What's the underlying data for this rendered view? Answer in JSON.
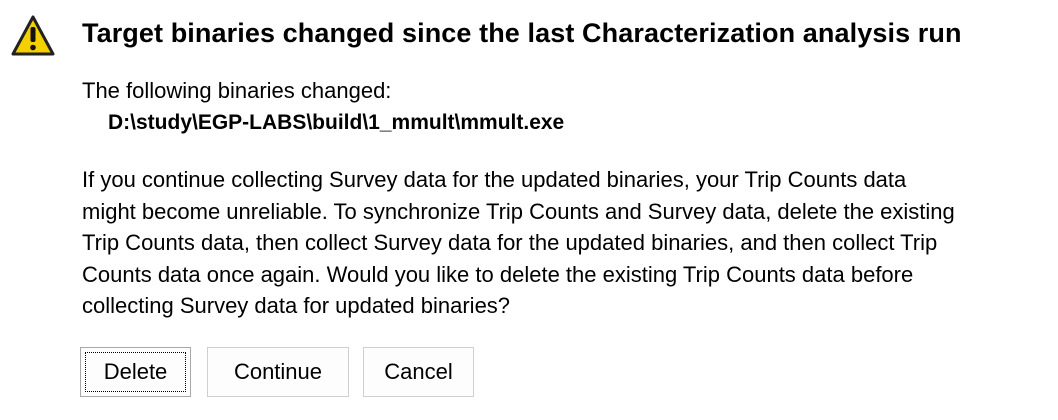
{
  "dialog": {
    "title": "Target binaries changed since the last Characterization analysis run",
    "icon": "warning-icon",
    "changed_label": "The following binaries changed:",
    "binaries": [
      "D:\\study\\EGP-LABS\\build\\1_mmult\\mmult.exe"
    ],
    "message_lines": [
      "If you continue collecting Survey data for the updated binaries, your Trip Counts data",
      "might become unreliable. To synchronize Trip Counts and Survey data, delete the existing",
      "Trip Counts data, then collect Survey data for the updated binaries, and then collect Trip",
      "Counts data once again. Would you like to delete the existing Trip Counts data before",
      "collecting Survey data for updated binaries?"
    ],
    "buttons": {
      "delete": "Delete",
      "continue": "Continue",
      "cancel": "Cancel"
    },
    "colors": {
      "warning_fill": "#f5d000",
      "warning_outline": "#222222",
      "button_border": "#cfcfcf"
    }
  }
}
